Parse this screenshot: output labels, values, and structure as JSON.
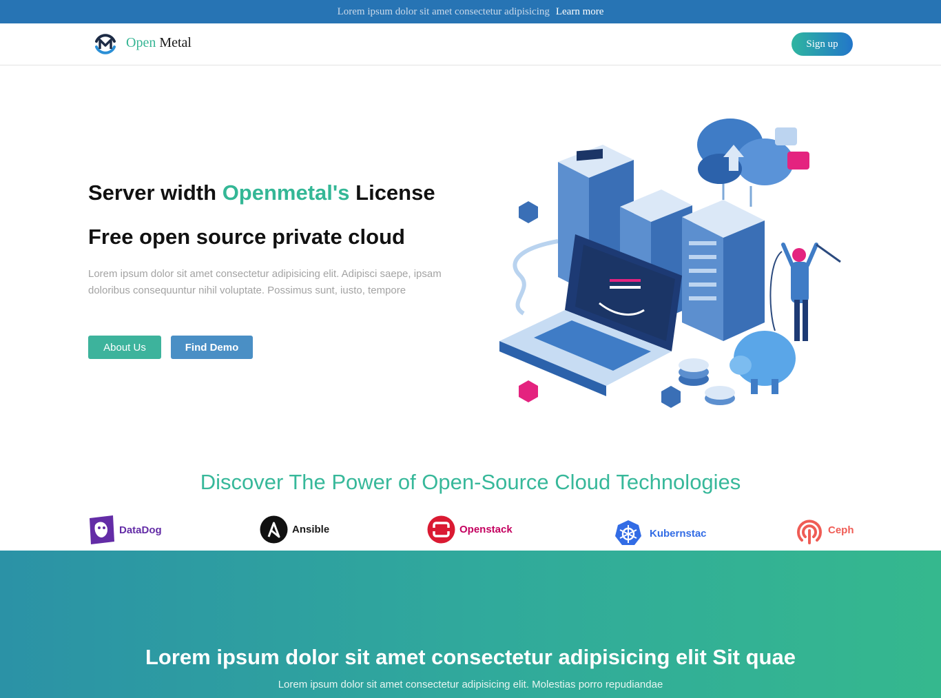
{
  "announcement": {
    "message": "Lorem ipsum dolor sit amet consectetur adipisicing",
    "link_label": "Learn more"
  },
  "nav": {
    "brand_part1": "Open",
    "brand_part2": "Metal",
    "signup_label": "Sign up"
  },
  "hero": {
    "title_prefix": "Server width",
    "title_accent": "Openmetal's",
    "title_suffix": "License",
    "subtitle": "Free open source private cloud",
    "description": "Lorem ipsum dolor sit amet consectetur adipisicing elit. Adipisci saepe, ipsam doloribus consequuntur nihil voluptate. Possimus sunt, iusto, tempore",
    "about_label": "About Us",
    "demo_label": "Find Demo"
  },
  "discover": {
    "heading": "Discover The Power of Open-Source Cloud Technologies"
  },
  "technologies": [
    {
      "name": "DataDog",
      "icon": "datadog-icon",
      "color": "#632ca6"
    },
    {
      "name": "Ansible",
      "icon": "ansible-icon",
      "color": "#1a1a1a"
    },
    {
      "name": "Openstack",
      "icon": "openstack-icon",
      "color": "#c4005f"
    },
    {
      "name": "Kubernstac",
      "icon": "kubernetes-icon",
      "color": "#326ce5"
    },
    {
      "name": "Ceph",
      "icon": "ceph-icon",
      "color": "#ef5c55"
    }
  ],
  "cta": {
    "title": "Lorem ipsum dolor sit amet consectetur adipisicing elit Sit quae",
    "subtitle": "Lorem ipsum dolor sit amet consectetur adipisicing elit. Molestias porro repudiandae"
  },
  "colors": {
    "announcement_bg": "#2774b4",
    "accent_green": "#34b796",
    "about_button": "#3db39c",
    "demo_button": "#4a8fc5"
  }
}
